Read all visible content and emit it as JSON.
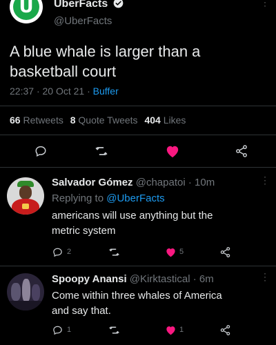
{
  "main_tweet": {
    "author_name": "UberFacts",
    "handle": "@UberFacts",
    "avatar_letter": "Ü",
    "text_line1": "A blue whale is larger than a",
    "text_line2": "basketball court",
    "time": "22:37",
    "sep1": "·",
    "date": "20 Oct 21",
    "sep2": "·",
    "source": "Buffer",
    "stats": {
      "retweets_count": "66",
      "retweets_label": "Retweets",
      "quotes_count": "8",
      "quotes_label": "Quote Tweets",
      "likes_count": "404",
      "likes_label": "Likes"
    },
    "liked": true
  },
  "replies": [
    {
      "author_name": "Salvador Gómez",
      "handle": "@chapatoi",
      "sep": "·",
      "time": "10m",
      "replying_prefix": "Replying to",
      "replying_handle": "@UberFacts",
      "text_line1": "americans will use anything but the",
      "text_line2": "metric system",
      "reply_count": "2",
      "like_count": "5"
    },
    {
      "author_name": "Spoopy Anansi",
      "handle": "@Kirktastical",
      "sep": "·",
      "time": "6m",
      "text_line1": "Come within three whales of America",
      "text_line2": "and say that.",
      "reply_count": "1",
      "like_count": "1"
    }
  ],
  "colors": {
    "background": "#000000",
    "text": "#e7e9ea",
    "muted": "#71767b",
    "accent_link": "#1d9bf0",
    "like_pink": "#f91880",
    "brand_green": "#1aa84a",
    "divider": "#2f3336"
  },
  "icons": [
    "verified-badge-icon",
    "reply-icon",
    "retweet-icon",
    "heart-icon",
    "share-icon",
    "more-icon"
  ]
}
